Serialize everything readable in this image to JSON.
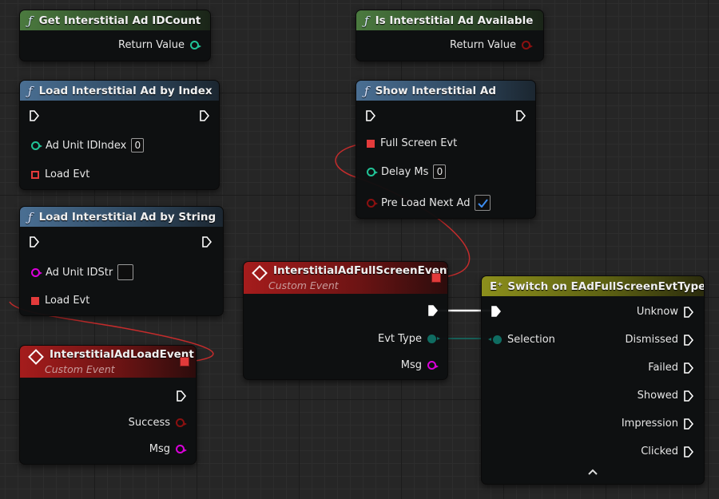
{
  "colors": {
    "exec": "#ffffff",
    "int_pin": "#21c397",
    "bool_pin": "#8b1010",
    "string_pin": "#da00da",
    "delegate_pin": "#e33b3b",
    "enum_pin": "#0f6c61",
    "wire_red": "#c42c2c",
    "wire_exec": "#ffffff",
    "wire_enum": "#127066",
    "function_header": "#4a7ab0",
    "pure_function_header": "#4f8a41",
    "event_header": "#a51c1c",
    "switch_header": "#8c8f1c"
  },
  "nodes": {
    "get_count": {
      "title": "Get Interstitial Ad IDCount",
      "icon": "function-icon",
      "return_label": "Return Value"
    },
    "is_available": {
      "title": "Is Interstitial Ad Available",
      "icon": "function-icon",
      "return_label": "Return Value"
    },
    "load_by_index": {
      "title": "Load Interstitial Ad by Index",
      "icon": "function-icon",
      "ad_unit_label": "Ad Unit IDIndex",
      "ad_unit_value": "0",
      "load_evt_label": "Load Evt"
    },
    "show_ad": {
      "title": "Show Interstitial Ad",
      "icon": "function-icon",
      "full_screen_evt_label": "Full Screen Evt",
      "delay_label": "Delay Ms",
      "delay_value": "0",
      "preload_label": "Pre Load Next Ad",
      "preload_checked": true
    },
    "load_by_string": {
      "title": "Load Interstitial Ad by String",
      "icon": "function-icon",
      "ad_unit_label": "Ad Unit IDStr",
      "ad_unit_value": "",
      "load_evt_label": "Load Evt"
    },
    "fullscreen_event": {
      "title": "InterstitialAdFullScreenEvent",
      "subtitle": "Custom Event",
      "evt_type_label": "Evt Type",
      "msg_label": "Msg"
    },
    "load_event": {
      "title": "InterstitialAdLoadEvent",
      "subtitle": "Custom Event",
      "success_label": "Success",
      "msg_label": "Msg"
    },
    "switch": {
      "title": "Switch on EAdFullScreenEvtType",
      "selection_label": "Selection",
      "outputs": [
        "Unknow",
        "Dismissed",
        "Failed",
        "Showed",
        "Impression",
        "Clicked"
      ],
      "collapse_icon": "chevron-up-icon"
    }
  }
}
